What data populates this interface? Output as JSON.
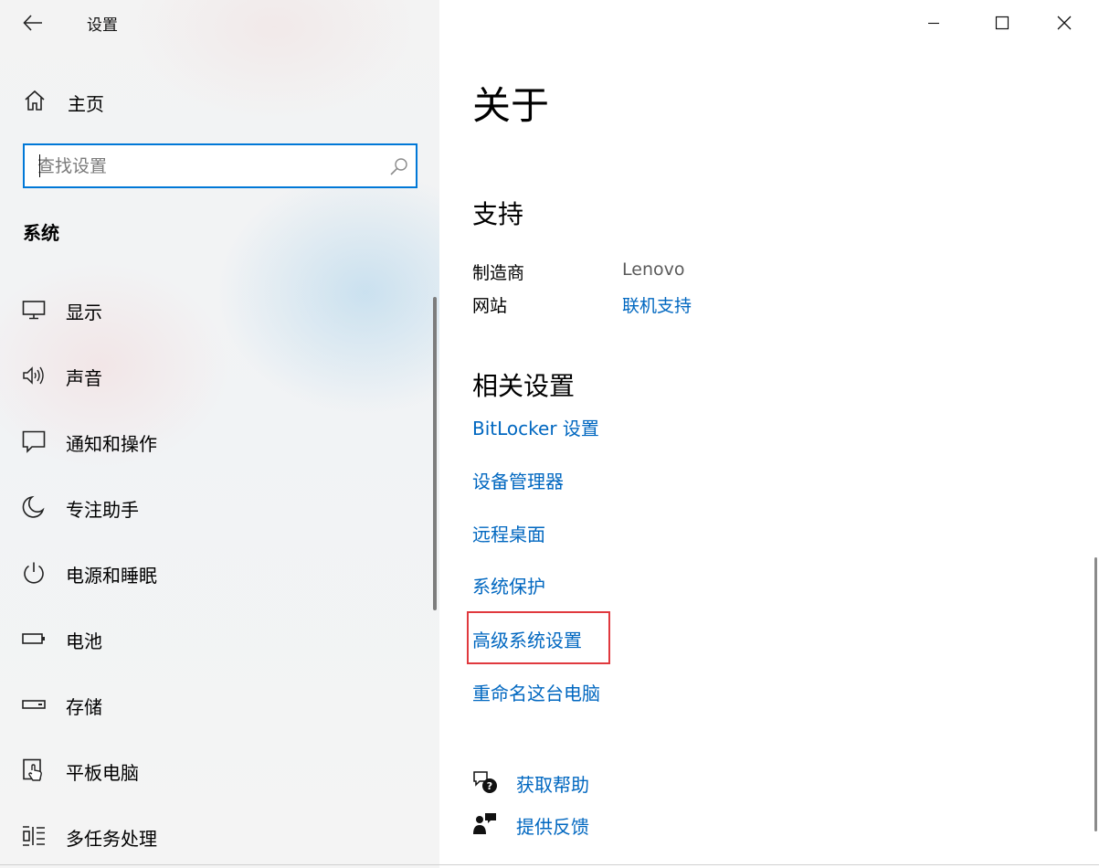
{
  "window": {
    "title": "设置",
    "back_icon": "back-arrow-icon",
    "minimize_icon": "minimize-icon",
    "maximize_icon": "maximize-icon",
    "close_icon": "close-icon"
  },
  "sidebar": {
    "home_label": "主页",
    "search": {
      "placeholder": "查找设置",
      "value": ""
    },
    "section_title": "系统",
    "items": [
      {
        "label": "显示",
        "icon": "monitor-icon"
      },
      {
        "label": "声音",
        "icon": "speaker-icon"
      },
      {
        "label": "通知和操作",
        "icon": "notification-icon"
      },
      {
        "label": "专注助手",
        "icon": "moon-icon"
      },
      {
        "label": "电源和睡眠",
        "icon": "power-icon"
      },
      {
        "label": "电池",
        "icon": "battery-icon"
      },
      {
        "label": "存储",
        "icon": "storage-icon"
      },
      {
        "label": "平板电脑",
        "icon": "tablet-icon"
      },
      {
        "label": "多任务处理",
        "icon": "multitasking-icon"
      }
    ]
  },
  "main": {
    "page_title": "关于",
    "support": {
      "heading": "支持",
      "manufacturer_label": "制造商",
      "manufacturer_value": "Lenovo",
      "website_label": "网站",
      "website_link": "联机支持"
    },
    "related": {
      "heading": "相关设置",
      "links": [
        "BitLocker 设置",
        "设备管理器",
        "远程桌面",
        "系统保护",
        "高级系统设置",
        "重命名这台电脑"
      ]
    },
    "help": {
      "get_help": "获取帮助",
      "feedback": "提供反馈"
    }
  },
  "colors": {
    "accent": "#0078d7",
    "link": "#0067c0",
    "highlight_box": "#e0393e"
  }
}
